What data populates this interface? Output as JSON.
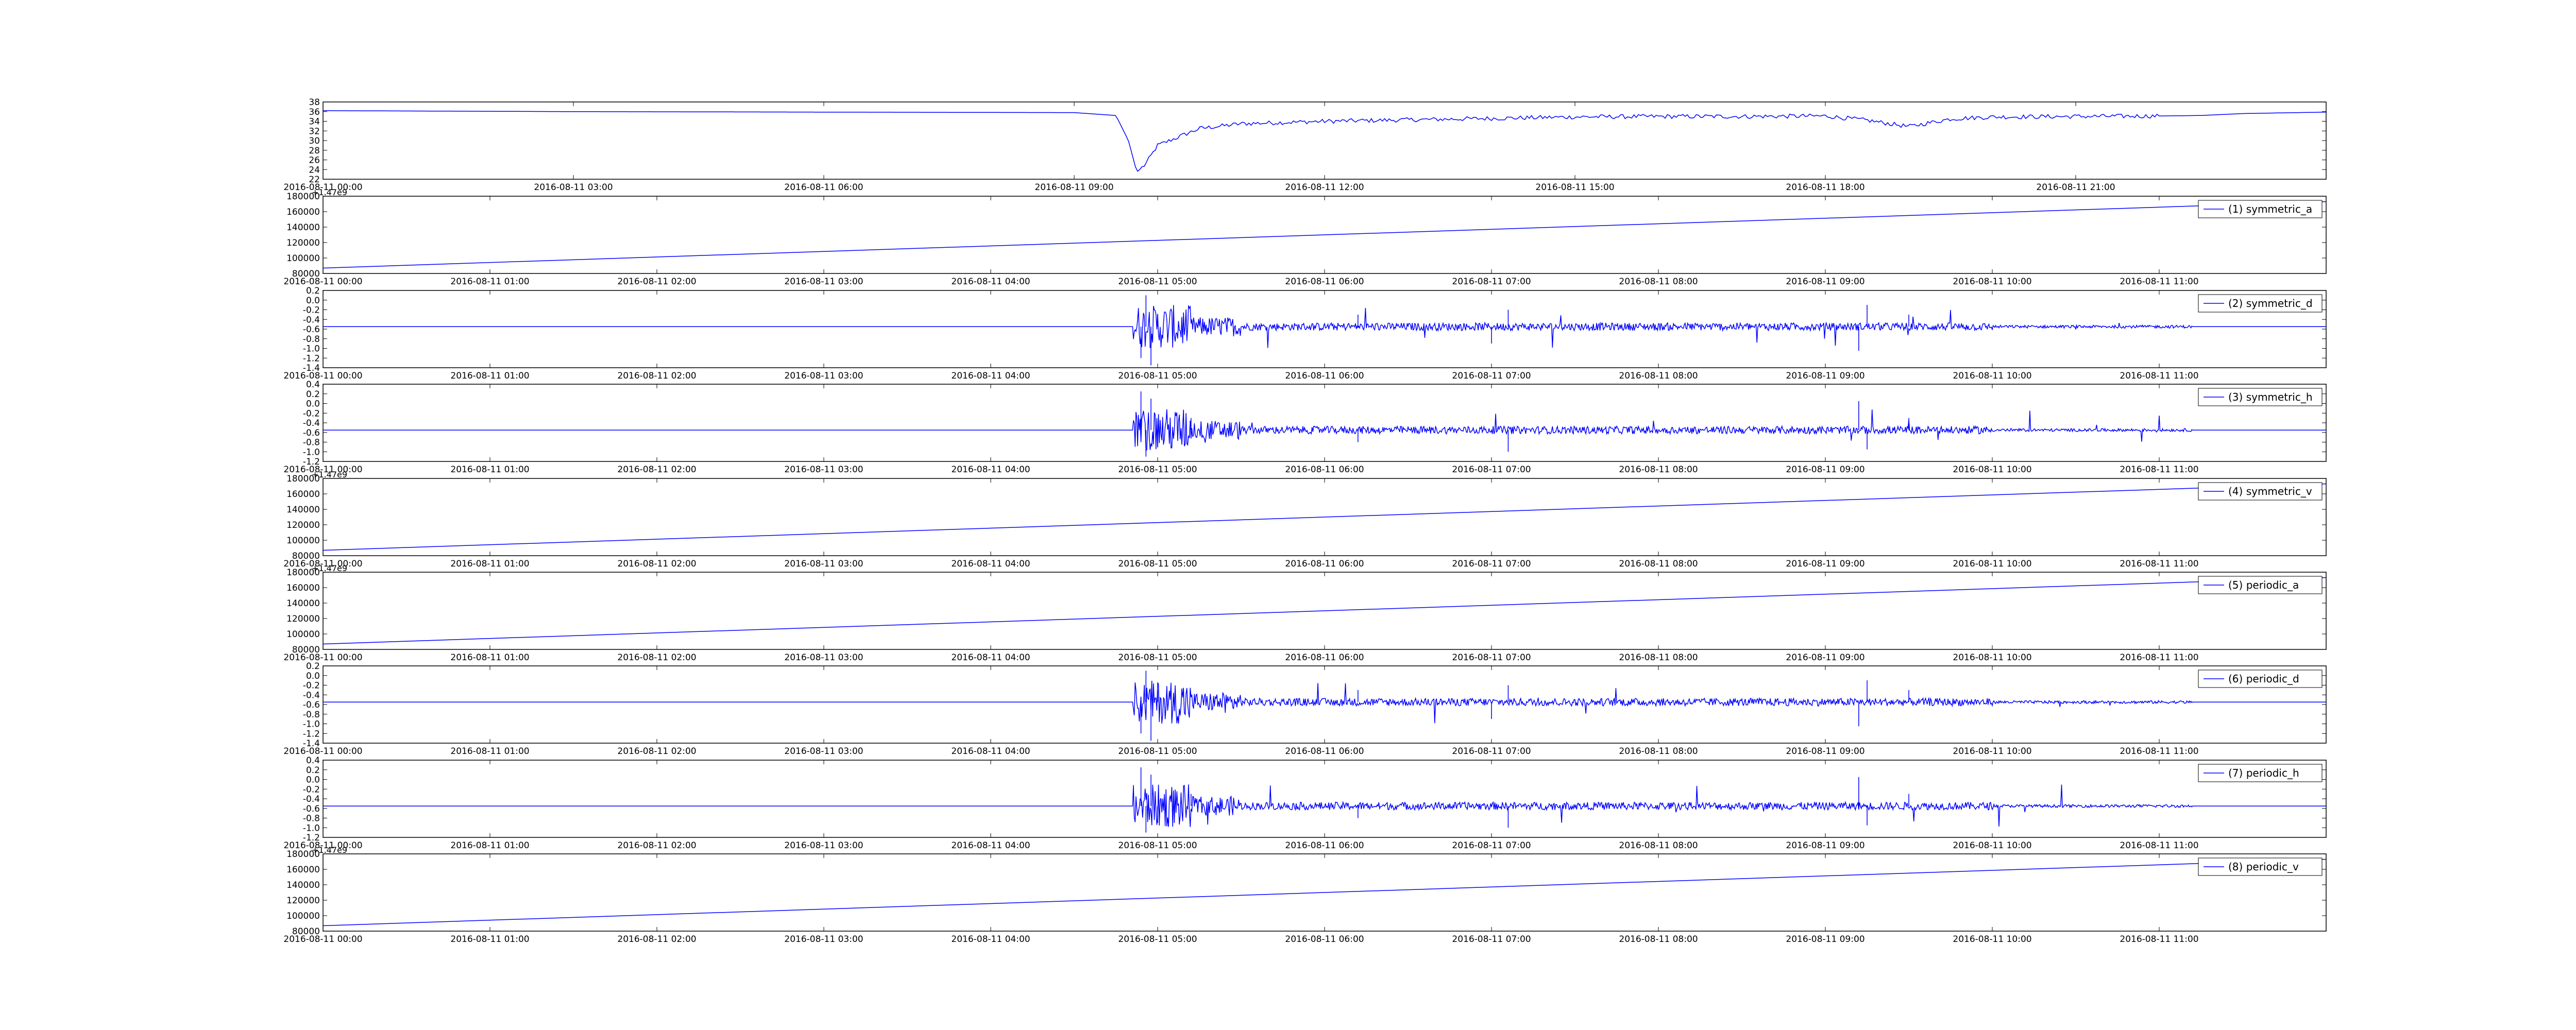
{
  "chart_data": [
    {
      "panel": 0,
      "type": "line",
      "color": "#0000ff",
      "x_ticks": [
        "2016-08-11 00:00",
        "2016-08-11 03:00",
        "2016-08-11 06:00",
        "2016-08-11 09:00",
        "2016-08-11 12:00",
        "2016-08-11 15:00",
        "2016-08-11 18:00",
        "2016-08-11 21:00"
      ],
      "xlim_hours": [
        0,
        24
      ],
      "y_ticks": [
        "22",
        "24",
        "26",
        "28",
        "30",
        "32",
        "34",
        "36",
        "38"
      ],
      "ylim": [
        22,
        38
      ],
      "series": [
        {
          "x_hours": [
            0,
            3,
            6,
            9,
            9.5,
            9.65,
            9.75,
            9.85,
            10,
            10.5,
            11,
            12,
            13,
            14,
            15,
            16,
            17,
            18,
            18.5,
            19,
            19.5,
            20,
            21,
            22,
            22.5,
            23,
            24
          ],
          "values": [
            36.2,
            36.0,
            35.9,
            35.8,
            35.2,
            30,
            23.5,
            25,
            29,
            32.5,
            33.5,
            34,
            34.3,
            34.6,
            34.9,
            35,
            35,
            35.1,
            34.2,
            32.9,
            34.5,
            34.9,
            35,
            35.1,
            35.2,
            35.6,
            35.9
          ]
        }
      ]
    },
    {
      "panel": 1,
      "type": "line",
      "color": "#0000ff",
      "y_offset_label": "+1.47e9",
      "y_ticks": [
        "80000",
        "100000",
        "120000",
        "140000",
        "160000",
        "180000"
      ],
      "ylim": [
        80000,
        180000
      ],
      "x_ticks": [
        "2016-08-11 00:00",
        "2016-08-11 01:00",
        "2016-08-11 02:00",
        "2016-08-11 03:00",
        "2016-08-11 04:00",
        "2016-08-11 05:00",
        "2016-08-11 06:00",
        "2016-08-11 07:00",
        "2016-08-11 08:00",
        "2016-08-11 09:00",
        "2016-08-11 10:00",
        "2016-08-11 11:00"
      ],
      "xlim_hours": [
        0,
        12
      ],
      "legend": "(1) symmetric_a",
      "series": [
        {
          "x_hours": [
            0,
            12
          ],
          "values": [
            87000,
            173000
          ]
        }
      ]
    },
    {
      "panel": 2,
      "type": "line",
      "color": "#0000ff",
      "y_ticks": [
        "-1.4",
        "-1.2",
        "-1.0",
        "-0.8",
        "-0.6",
        "-0.4",
        "-0.2",
        "0.0",
        "0.2"
      ],
      "ylim": [
        -1.4,
        0.2
      ],
      "x_ticks": [
        "2016-08-11 00:00",
        "2016-08-11 01:00",
        "2016-08-11 02:00",
        "2016-08-11 03:00",
        "2016-08-11 04:00",
        "2016-08-11 05:00",
        "2016-08-11 06:00",
        "2016-08-11 07:00",
        "2016-08-11 08:00",
        "2016-08-11 09:00",
        "2016-08-11 10:00",
        "2016-08-11 11:00"
      ],
      "xlim_hours": [
        0,
        12
      ],
      "legend": "(2) symmetric_d",
      "baseline": -0.55,
      "series": [
        {
          "x_hours": [
            0,
            4.85,
            4.9,
            4.93,
            4.96,
            5.0,
            5.2,
            6.2,
            7.0,
            7.1,
            8.0,
            9.2,
            9.25,
            9.5,
            10.0,
            11.0,
            12.0
          ],
          "values": [
            -0.55,
            -0.55,
            -1.2,
            0.1,
            -1.35,
            -0.3,
            -0.7,
            -0.3,
            -0.9,
            -0.2,
            -0.6,
            -1.05,
            -0.1,
            -0.3,
            -0.55,
            -0.55,
            -0.55
          ]
        }
      ]
    },
    {
      "panel": 3,
      "type": "line",
      "color": "#0000ff",
      "y_ticks": [
        "-1.2",
        "-1.0",
        "-0.8",
        "-0.6",
        "-0.4",
        "-0.2",
        "0.0",
        "0.2",
        "0.4"
      ],
      "ylim": [
        -1.2,
        0.4
      ],
      "x_ticks": [
        "2016-08-11 00:00",
        "2016-08-11 01:00",
        "2016-08-11 02:00",
        "2016-08-11 03:00",
        "2016-08-11 04:00",
        "2016-08-11 05:00",
        "2016-08-11 06:00",
        "2016-08-11 07:00",
        "2016-08-11 08:00",
        "2016-08-11 09:00",
        "2016-08-11 10:00",
        "2016-08-11 11:00"
      ],
      "xlim_hours": [
        0,
        12
      ],
      "legend": "(3) symmetric_h",
      "baseline": -0.55,
      "series": [
        {
          "x_hours": [
            0,
            4.85,
            4.9,
            4.93,
            4.96,
            5.0,
            5.2,
            6.2,
            7.1,
            8.0,
            9.2,
            9.25,
            9.5,
            10.0,
            11.0,
            12.0
          ],
          "values": [
            -0.55,
            -0.55,
            0.25,
            -1.1,
            0.1,
            -0.9,
            -0.3,
            -0.8,
            -1.0,
            -0.4,
            0.05,
            -0.95,
            -0.3,
            -0.55,
            -0.55,
            -0.55
          ]
        }
      ]
    },
    {
      "panel": 4,
      "type": "line",
      "color": "#0000ff",
      "y_offset_label": "+1.47e9",
      "y_ticks": [
        "80000",
        "100000",
        "120000",
        "140000",
        "160000",
        "180000"
      ],
      "ylim": [
        80000,
        180000
      ],
      "x_ticks": [
        "2016-08-11 00:00",
        "2016-08-11 01:00",
        "2016-08-11 02:00",
        "2016-08-11 03:00",
        "2016-08-11 04:00",
        "2016-08-11 05:00",
        "2016-08-11 06:00",
        "2016-08-11 07:00",
        "2016-08-11 08:00",
        "2016-08-11 09:00",
        "2016-08-11 10:00",
        "2016-08-11 11:00"
      ],
      "xlim_hours": [
        0,
        12
      ],
      "legend": "(4) symmetric_v",
      "series": [
        {
          "x_hours": [
            0,
            12
          ],
          "values": [
            87000,
            173000
          ]
        }
      ]
    },
    {
      "panel": 5,
      "type": "line",
      "color": "#0000ff",
      "y_offset_label": "+1.47e9",
      "y_ticks": [
        "80000",
        "100000",
        "120000",
        "140000",
        "160000",
        "180000"
      ],
      "ylim": [
        80000,
        180000
      ],
      "x_ticks": [
        "2016-08-11 00:00",
        "2016-08-11 01:00",
        "2016-08-11 02:00",
        "2016-08-11 03:00",
        "2016-08-11 04:00",
        "2016-08-11 05:00",
        "2016-08-11 06:00",
        "2016-08-11 07:00",
        "2016-08-11 08:00",
        "2016-08-11 09:00",
        "2016-08-11 10:00",
        "2016-08-11 11:00"
      ],
      "xlim_hours": [
        0,
        12
      ],
      "legend": "(5) periodic_a",
      "series": [
        {
          "x_hours": [
            0,
            12
          ],
          "values": [
            87000,
            173000
          ]
        }
      ]
    },
    {
      "panel": 6,
      "type": "line",
      "color": "#0000ff",
      "y_ticks": [
        "-1.4",
        "-1.2",
        "-1.0",
        "-0.8",
        "-0.6",
        "-0.4",
        "-0.2",
        "0.0",
        "0.2"
      ],
      "ylim": [
        -1.4,
        0.2
      ],
      "x_ticks": [
        "2016-08-11 00:00",
        "2016-08-11 01:00",
        "2016-08-11 02:00",
        "2016-08-11 03:00",
        "2016-08-11 04:00",
        "2016-08-11 05:00",
        "2016-08-11 06:00",
        "2016-08-11 07:00",
        "2016-08-11 08:00",
        "2016-08-11 09:00",
        "2016-08-11 10:00",
        "2016-08-11 11:00"
      ],
      "xlim_hours": [
        0,
        12
      ],
      "legend": "(6) periodic_d",
      "baseline": -0.55,
      "series": [
        {
          "x_hours": [
            0,
            4.85,
            4.9,
            4.93,
            4.96,
            5.0,
            5.2,
            6.2,
            7.0,
            7.1,
            8.0,
            9.2,
            9.25,
            9.5,
            10.0,
            11.0,
            12.0
          ],
          "values": [
            -0.55,
            -0.55,
            -1.2,
            0.1,
            -1.35,
            -0.3,
            -0.7,
            -0.3,
            -0.9,
            -0.2,
            -0.6,
            -1.05,
            -0.1,
            -0.3,
            -0.55,
            -0.55,
            -0.55
          ]
        }
      ]
    },
    {
      "panel": 7,
      "type": "line",
      "color": "#0000ff",
      "y_ticks": [
        "-1.2",
        "-1.0",
        "-0.8",
        "-0.6",
        "-0.4",
        "-0.2",
        "0.0",
        "0.2",
        "0.4"
      ],
      "ylim": [
        -1.2,
        0.4
      ],
      "x_ticks": [
        "2016-08-11 00:00",
        "2016-08-11 01:00",
        "2016-08-11 02:00",
        "2016-08-11 03:00",
        "2016-08-11 04:00",
        "2016-08-11 05:00",
        "2016-08-11 06:00",
        "2016-08-11 07:00",
        "2016-08-11 08:00",
        "2016-08-11 09:00",
        "2016-08-11 10:00",
        "2016-08-11 11:00"
      ],
      "xlim_hours": [
        0,
        12
      ],
      "legend": "(7) periodic_h",
      "baseline": -0.55,
      "series": [
        {
          "x_hours": [
            0,
            4.85,
            4.9,
            4.93,
            4.96,
            5.0,
            5.2,
            6.2,
            7.1,
            8.0,
            9.2,
            9.25,
            9.5,
            10.0,
            11.0,
            12.0
          ],
          "values": [
            -0.55,
            -0.55,
            0.25,
            -1.1,
            0.1,
            -0.9,
            -0.3,
            -0.8,
            -1.0,
            -0.4,
            0.05,
            -0.95,
            -0.3,
            -0.55,
            -0.55,
            -0.55
          ]
        }
      ]
    },
    {
      "panel": 8,
      "type": "line",
      "color": "#0000ff",
      "y_offset_label": "+1.47e9",
      "y_ticks": [
        "80000",
        "100000",
        "120000",
        "140000",
        "160000",
        "180000"
      ],
      "ylim": [
        80000,
        180000
      ],
      "x_ticks": [
        "2016-08-11 00:00",
        "2016-08-11 01:00",
        "2016-08-11 02:00",
        "2016-08-11 03:00",
        "2016-08-11 04:00",
        "2016-08-11 05:00",
        "2016-08-11 06:00",
        "2016-08-11 07:00",
        "2016-08-11 08:00",
        "2016-08-11 09:00",
        "2016-08-11 10:00",
        "2016-08-11 11:00"
      ],
      "xlim_hours": [
        0,
        12
      ],
      "legend": "(8) periodic_v",
      "series": [
        {
          "x_hours": [
            0,
            12
          ],
          "values": [
            87000,
            173000
          ]
        }
      ]
    }
  ]
}
